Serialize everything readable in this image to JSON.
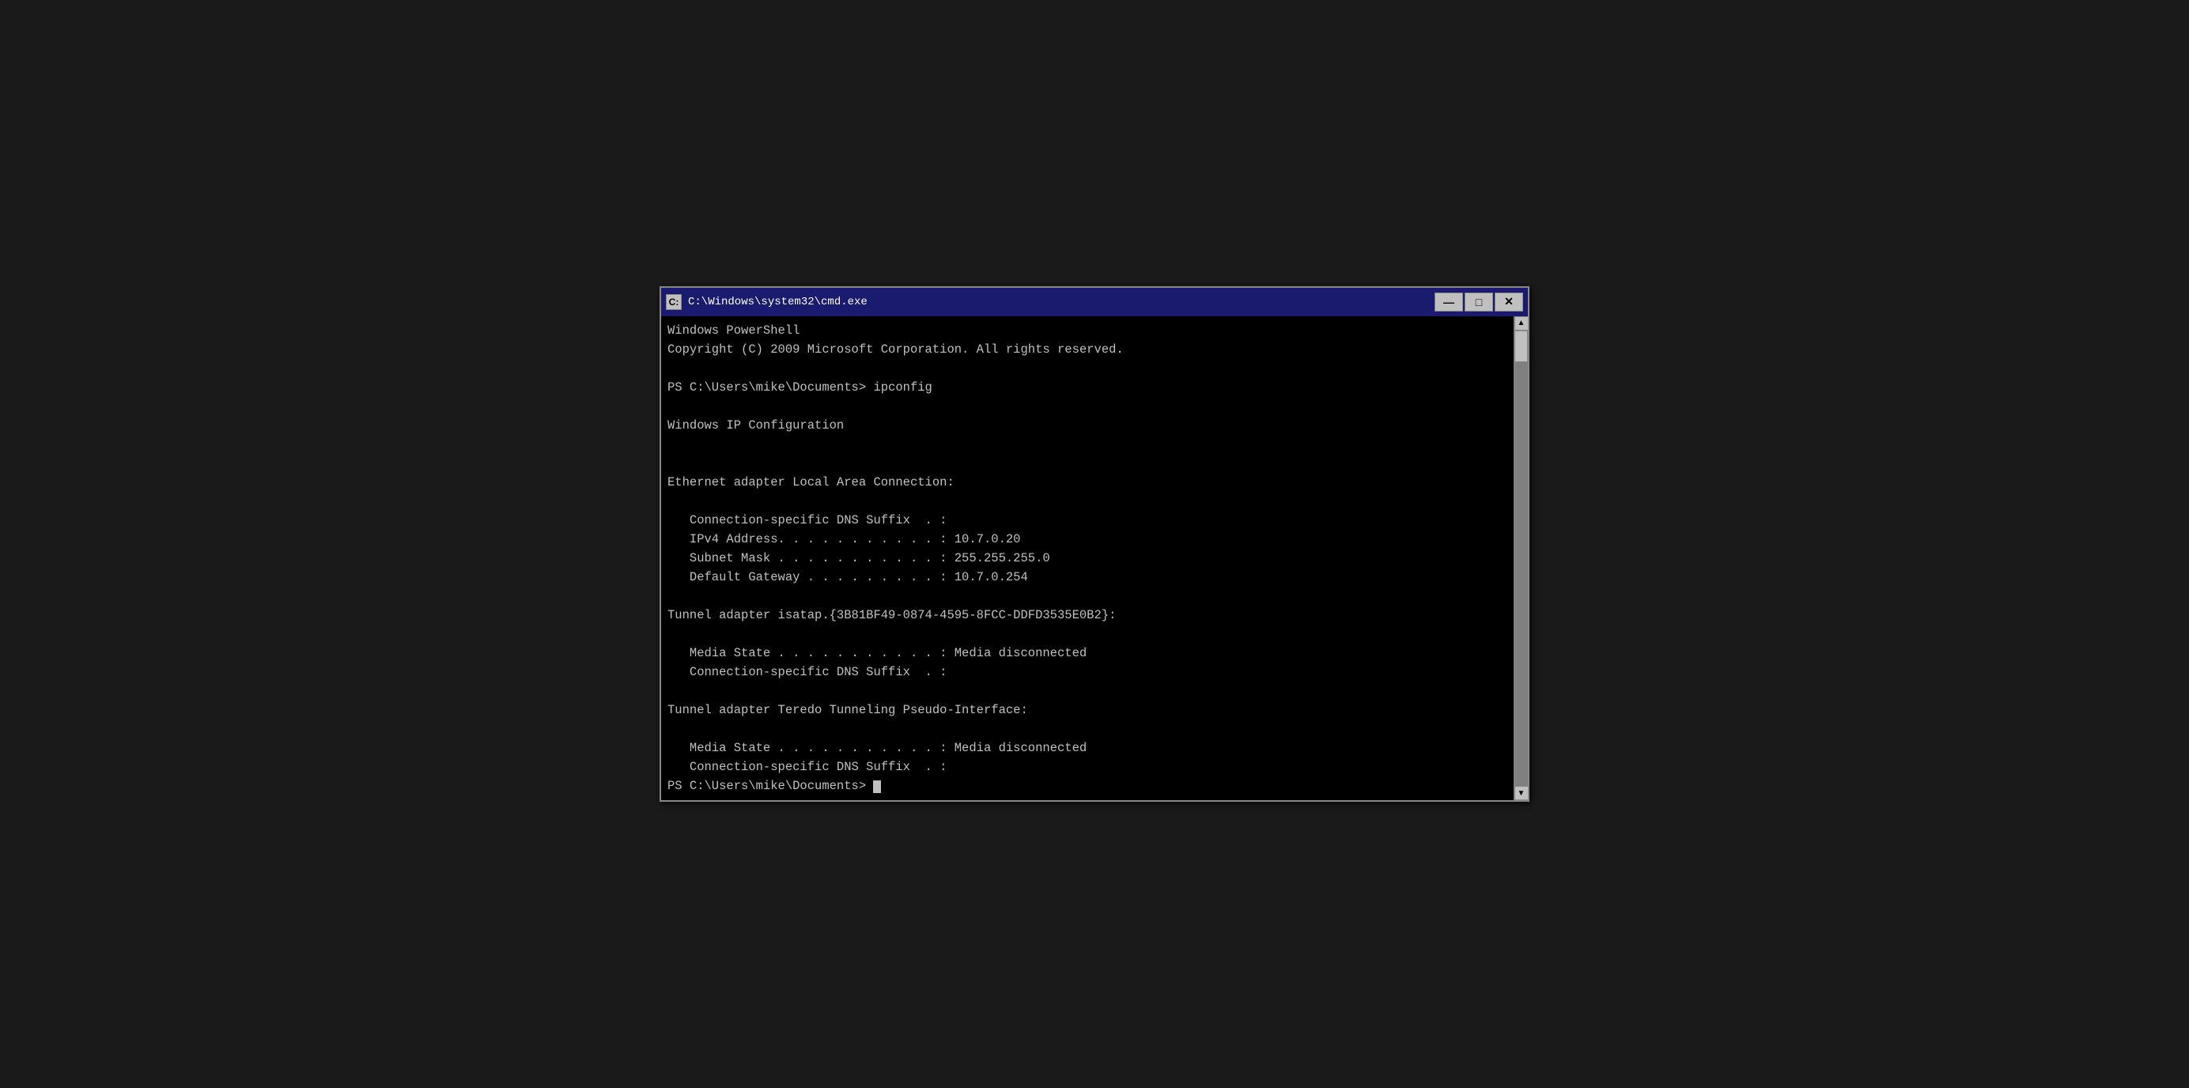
{
  "window": {
    "title": "C:\\Windows\\system32\\cmd.exe",
    "icon_label": "C:",
    "min_button": "—",
    "max_button": "□",
    "close_button": "✕"
  },
  "console": {
    "line1": "Windows PowerShell",
    "line2": "Copyright (C) 2009 Microsoft Corporation. All rights reserved.",
    "line3": "",
    "line4": "PS C:\\Users\\mike\\Documents> ipconfig",
    "line5": "",
    "line6": "Windows IP Configuration",
    "line7": "",
    "line8": "",
    "line9": "Ethernet adapter Local Area Connection:",
    "line10": "",
    "line11": "   Connection-specific DNS Suffix  . :",
    "line12": "   IPv4 Address. . . . . . . . . . . : 10.7.0.20",
    "line13": "   Subnet Mask . . . . . . . . . . . : 255.255.255.0",
    "line14": "   Default Gateway . . . . . . . . . : 10.7.0.254",
    "line15": "",
    "line16": "Tunnel adapter isatap.{3B81BF49-0874-4595-8FCC-DDFD3535E0B2}:",
    "line17": "",
    "line18": "   Media State . . . . . . . . . . . : Media disconnected",
    "line19": "   Connection-specific DNS Suffix  . :",
    "line20": "",
    "line21": "Tunnel adapter Teredo Tunneling Pseudo-Interface:",
    "line22": "",
    "line23": "   Media State . . . . . . . . . . . : Media disconnected",
    "line24": "   Connection-specific DNS Suffix  . :",
    "line25": "PS C:\\Users\\mike\\Documents> "
  }
}
